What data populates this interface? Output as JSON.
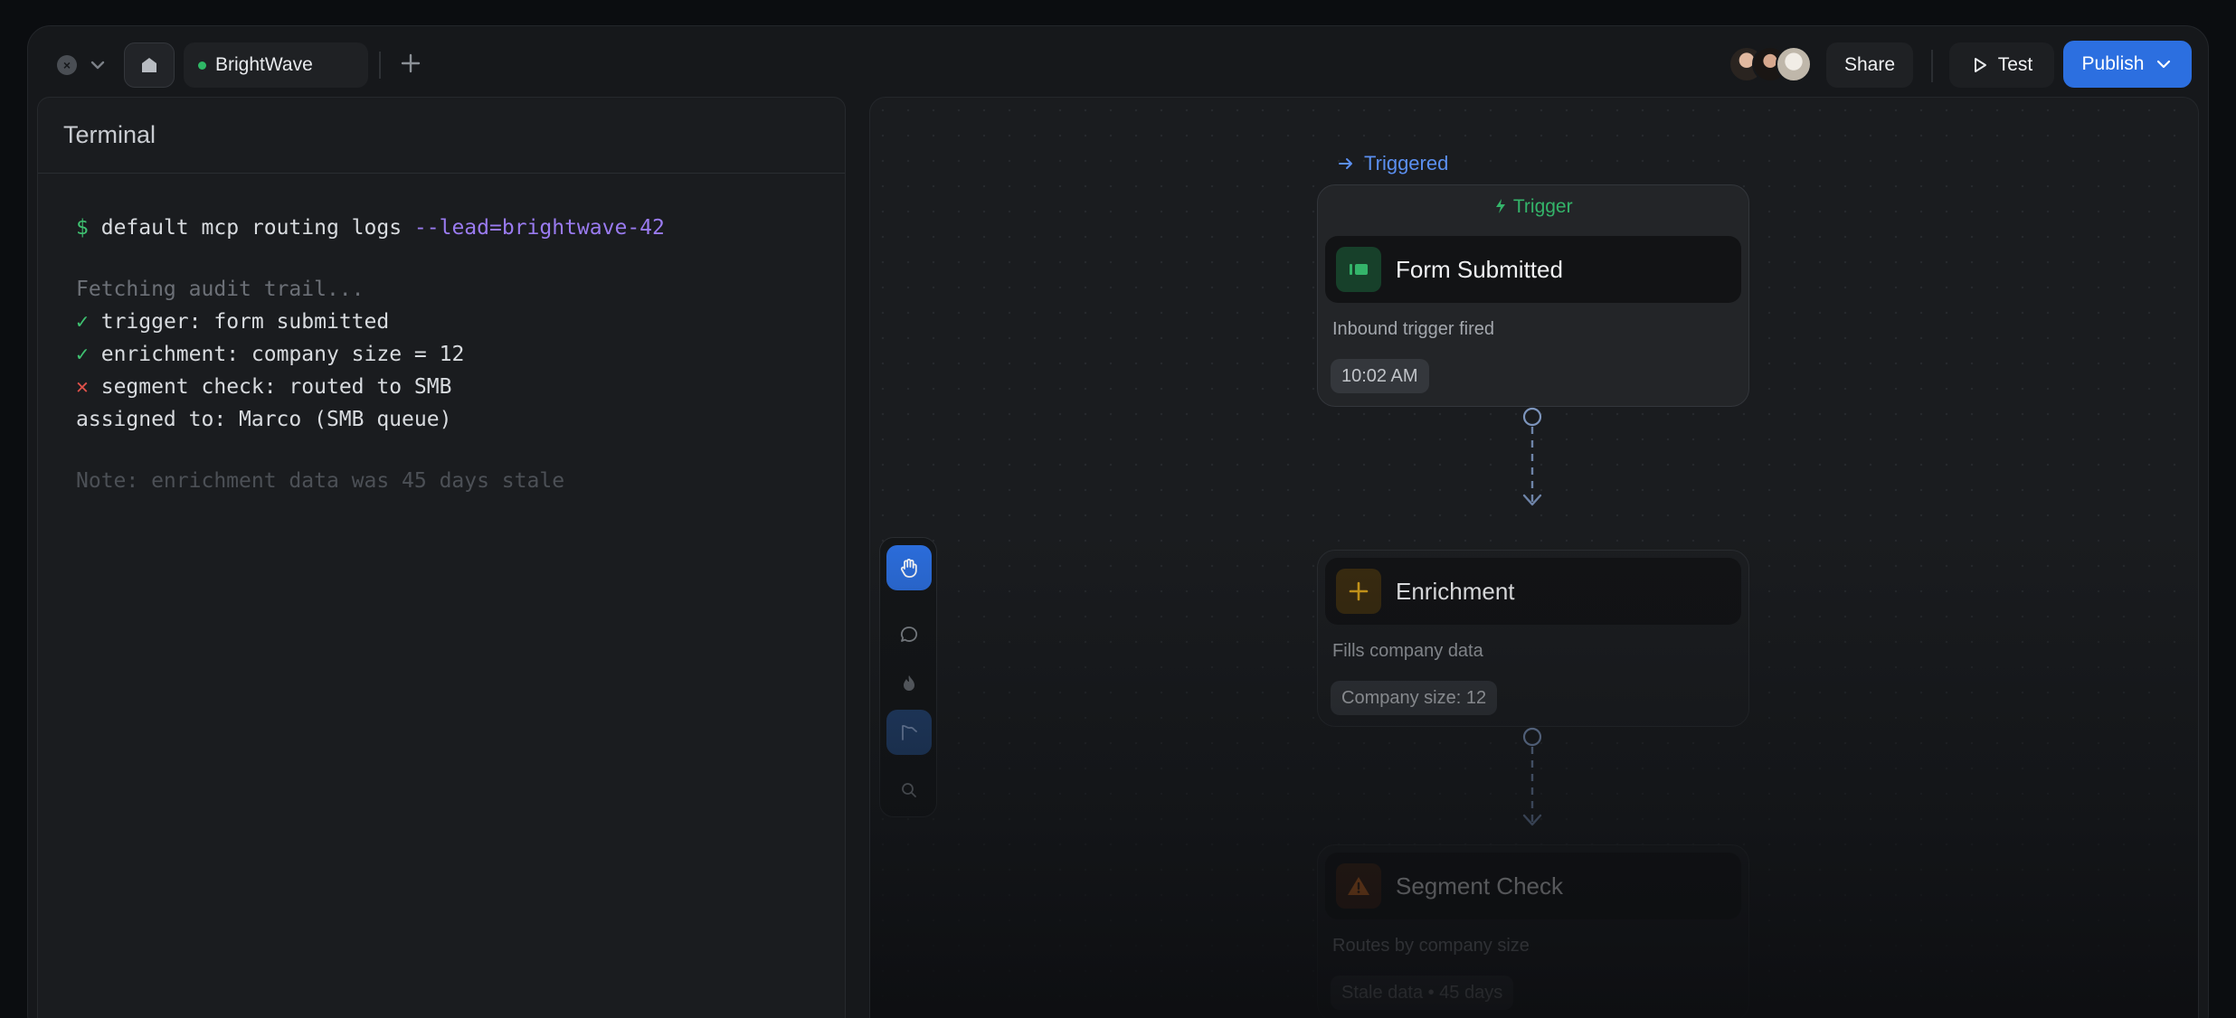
{
  "topbar": {
    "tab_name": "BrightWave",
    "share_label": "Share",
    "test_label": "Test",
    "publish_label": "Publish"
  },
  "terminal": {
    "title": "Terminal",
    "prompt": "$",
    "command": "default mcp routing logs",
    "flag": "--lead=brightwave-42",
    "fetching": "Fetching audit trail...",
    "steps": [
      {
        "status": "ok",
        "mark": "✓",
        "text": "trigger: form submitted"
      },
      {
        "status": "ok",
        "mark": "✓",
        "text": "enrichment: company size = 12"
      },
      {
        "status": "fail",
        "mark": "✕",
        "text": "segment check: routed to SMB"
      }
    ],
    "assigned": "assigned to: Marco (SMB queue)",
    "note": "Note: enrichment data was 45 days stale"
  },
  "canvas": {
    "triggered_label": "Triggered",
    "trigger_group_label": "Trigger",
    "nodes": [
      {
        "title": "Form Submitted",
        "desc": "Inbound trigger fired",
        "chip": "10:02 AM",
        "icon": "form-icon"
      },
      {
        "title": "Enrichment",
        "desc": "Fills company data",
        "chip": "Company size: 12",
        "icon": "plus-icon"
      },
      {
        "title": "Segment Check",
        "desc": "Routes by company size",
        "chip": "Stale data • 45 days",
        "icon": "warning-icon"
      }
    ],
    "tools": [
      "hand-icon",
      "comment-icon",
      "flame-icon",
      "path-icon",
      "search-icon"
    ]
  },
  "colors": {
    "accent": "#2c6fe0",
    "success": "#3ec070",
    "error": "#e0514a",
    "flag": "#9a7bf0",
    "warning": "#e0701e",
    "enrichment": "#d9a21a"
  }
}
